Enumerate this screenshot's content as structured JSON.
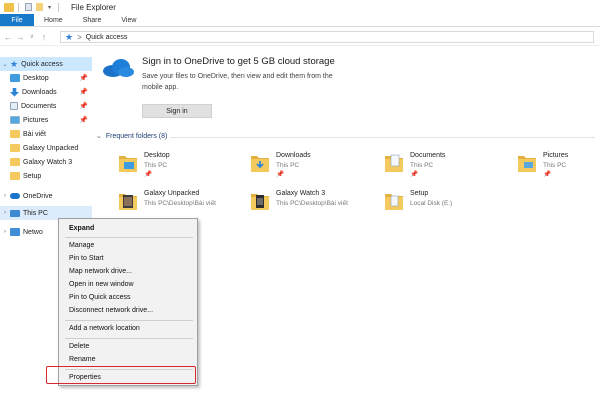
{
  "window": {
    "title": "File Explorer"
  },
  "ribbon": {
    "tabs": [
      "File",
      "Home",
      "Share",
      "View"
    ]
  },
  "address": {
    "path": "Quick access",
    "chevron": ">"
  },
  "nav": {
    "quick_access": "Quick access",
    "items": [
      {
        "label": "Desktop",
        "pinned": true,
        "icon": "desktop-folder-icon"
      },
      {
        "label": "Downloads",
        "pinned": true,
        "icon": "downloads-folder-icon"
      },
      {
        "label": "Documents",
        "pinned": true,
        "icon": "documents-folder-icon"
      },
      {
        "label": "Pictures",
        "pinned": true,
        "icon": "pictures-folder-icon"
      },
      {
        "label": "Bài viết",
        "pinned": false,
        "icon": "folder-icon"
      },
      {
        "label": "Galaxy Unpacked",
        "pinned": false,
        "icon": "folder-icon"
      },
      {
        "label": "Galaxy Watch 3",
        "pinned": false,
        "icon": "folder-icon"
      },
      {
        "label": "Setup",
        "pinned": false,
        "icon": "folder-icon"
      }
    ],
    "onedrive": "OneDrive",
    "thispc": "This PC",
    "network": "Netwo"
  },
  "banner": {
    "title": "Sign in to OneDrive to get 5 GB cloud storage",
    "description": "Save your files to OneDrive, then view and edit them from the mobile app.",
    "button": "Sign in"
  },
  "frequent": {
    "header": "Frequent folders (8)",
    "folders": [
      {
        "name": "Desktop",
        "location": "This PC",
        "pinned": true
      },
      {
        "name": "Downloads",
        "location": "This PC",
        "pinned": true
      },
      {
        "name": "Documents",
        "location": "This PC",
        "pinned": true
      },
      {
        "name": "Pictures",
        "location": "This PC",
        "pinned": true
      },
      {
        "name": "Galaxy Unpacked",
        "location": "This PC\\Desktop\\Bài viết",
        "pinned": false
      },
      {
        "name": "Galaxy Watch 3",
        "location": "This PC\\Desktop\\Bài viết",
        "pinned": false
      },
      {
        "name": "Setup",
        "location": "Local Disk (E:)",
        "pinned": false
      }
    ]
  },
  "context_menu": {
    "expand": "Expand",
    "manage": "Manage",
    "pin_start": "Pin to Start",
    "map_drive": "Map network drive...",
    "open_new": "Open in new window",
    "pin_quick": "Pin to Quick access",
    "disconnect": "Disconnect network drive...",
    "add_location": "Add a network location",
    "delete": "Delete",
    "rename": "Rename",
    "properties": "Properties"
  },
  "colors": {
    "accent": "#1979ca",
    "selection": "#cce8ff",
    "folder": "#f4c95d",
    "highlight_box": "#d8282f"
  }
}
